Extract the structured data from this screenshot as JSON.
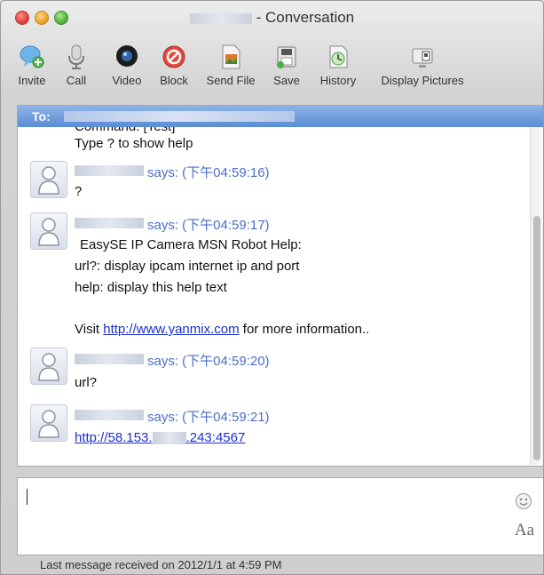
{
  "window": {
    "title": "- Conversation"
  },
  "toolbar": {
    "items": [
      {
        "label": "Invite",
        "icon": "invite-icon"
      },
      {
        "label": "Call",
        "icon": "microphone-icon"
      },
      {
        "label": "Video",
        "icon": "webcam-icon"
      },
      {
        "label": "Block",
        "icon": "block-icon"
      },
      {
        "label": "Send File",
        "icon": "send-file-icon"
      },
      {
        "label": "Save",
        "icon": "save-icon"
      },
      {
        "label": "History",
        "icon": "history-icon"
      },
      {
        "label": "Display Pictures",
        "icon": "display-pictures-icon"
      }
    ]
  },
  "to_bar": {
    "label": "To:"
  },
  "conversation": {
    "partial_line": "Command: [Test]",
    "help_line": "Type ? to show help",
    "messages": [
      {
        "says": "says: (下午04:59:16)",
        "lines": [
          "?"
        ]
      },
      {
        "says": "says: (下午04:59:17)",
        "lines": [
          "EasySE IP Camera MSN Robot Help:",
          "url?: display ipcam internet ip and port",
          "help: display this help text"
        ],
        "visit_prefix": "Visit ",
        "visit_link": "http://www.yanmix.com",
        "visit_suffix": " for more information.."
      },
      {
        "says": "says: (下午04:59:20)",
        "lines": [
          "url?"
        ]
      },
      {
        "says": "says: (下午04:59:21)",
        "link_prefix": "http://58.153.",
        "link_suffix": ".243:4567"
      }
    ]
  },
  "compose": {
    "font_button": "Aa",
    "emoji_icon": "smiley-icon"
  },
  "status": {
    "text": "Last message received on 2012/1/1 at 4:59 PM"
  },
  "colors": {
    "accent": "#5a8dd4",
    "sender_text": "#4a6ec9",
    "link": "#1a2fcc"
  }
}
